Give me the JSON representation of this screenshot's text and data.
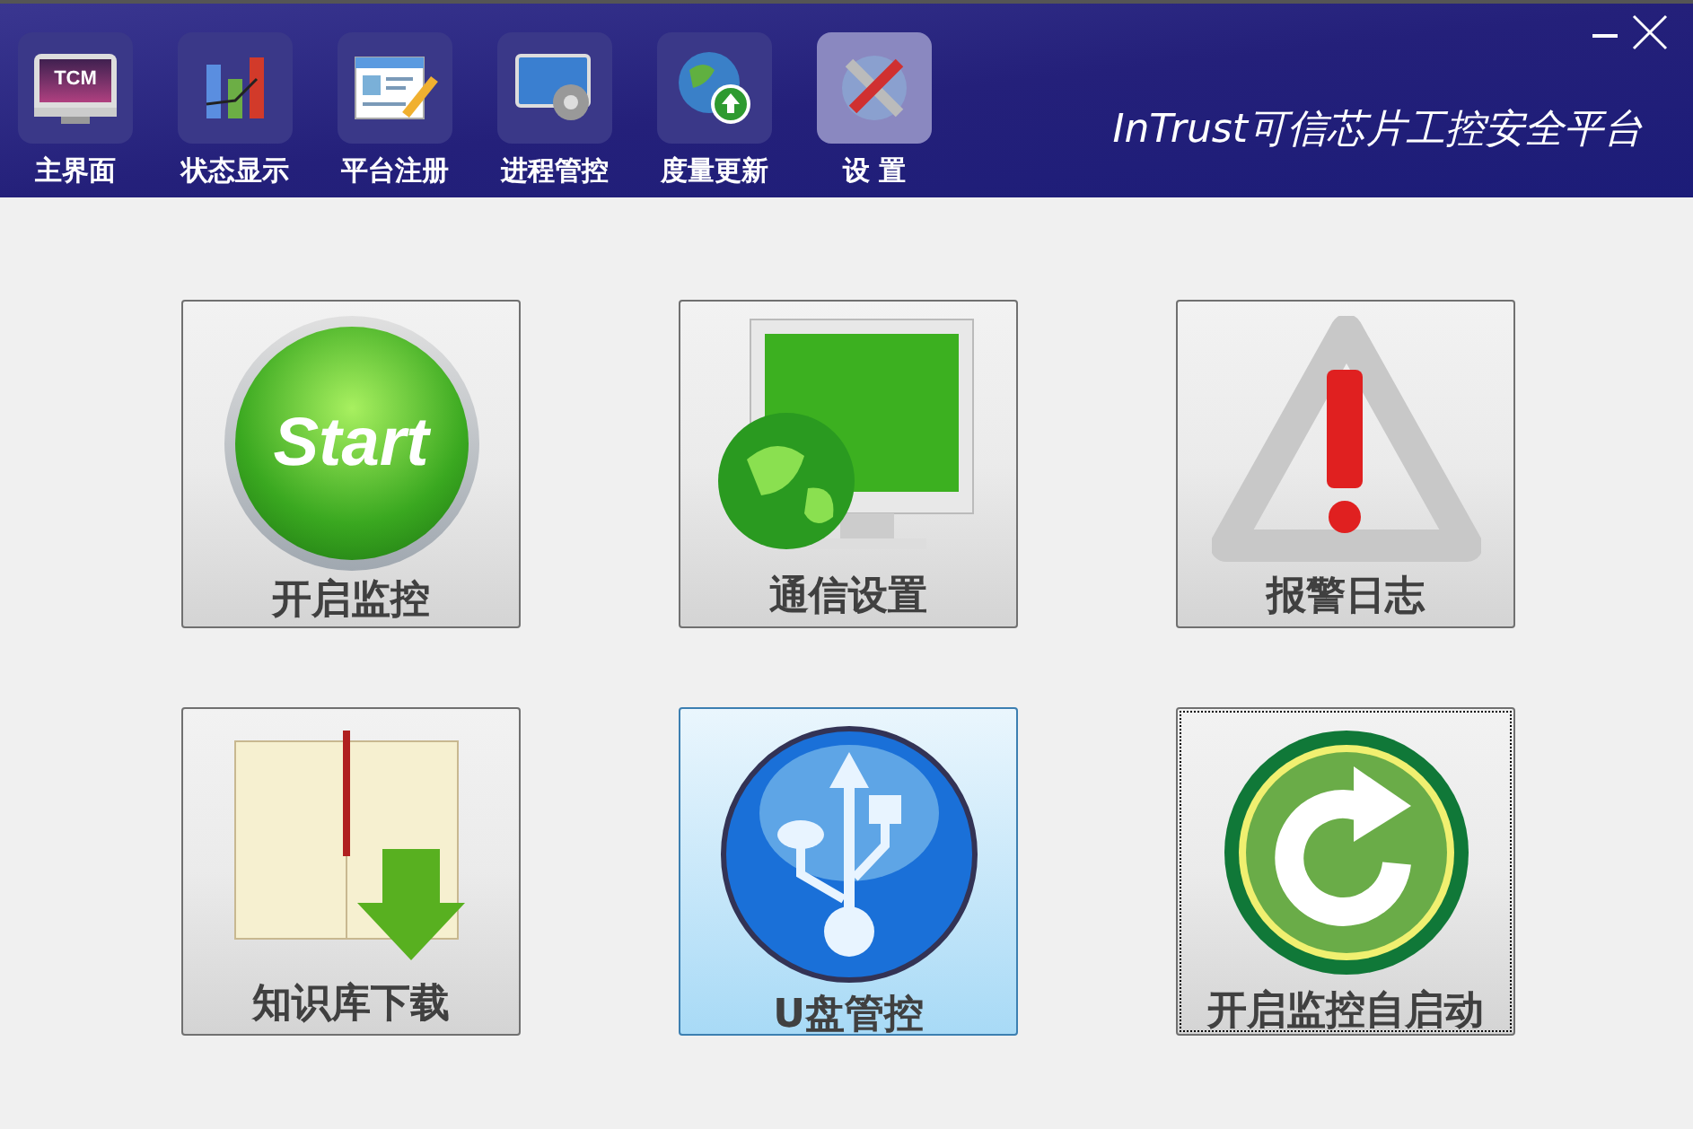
{
  "toolbar": [
    {
      "kind": "monitor",
      "label": "主界面",
      "selected": false,
      "icon_text": "TCM"
    },
    {
      "kind": "chart",
      "label": "状态显示",
      "selected": false
    },
    {
      "kind": "form",
      "label": "平台注册",
      "selected": false
    },
    {
      "kind": "process",
      "label": "进程管控",
      "selected": false
    },
    {
      "kind": "globe",
      "label": "度量更新",
      "selected": false
    },
    {
      "kind": "tools",
      "label": "设 置",
      "selected": true
    }
  ],
  "app_title": "InTrust可信芯片工控安全平台",
  "tiles": [
    {
      "kind": "start",
      "label": "开启监控",
      "icon_text": "Start",
      "hovered": false,
      "focused": false
    },
    {
      "kind": "screen",
      "label": "通信设置",
      "hovered": false,
      "focused": false
    },
    {
      "kind": "warning",
      "label": "报警日志",
      "hovered": false,
      "focused": false
    },
    {
      "kind": "book",
      "label": "知识库下载",
      "hovered": false,
      "focused": false
    },
    {
      "kind": "usb",
      "label": "U盘管控",
      "hovered": true,
      "focused": false
    },
    {
      "kind": "restart",
      "label": "开启监控自启动",
      "hovered": false,
      "focused": true
    }
  ]
}
